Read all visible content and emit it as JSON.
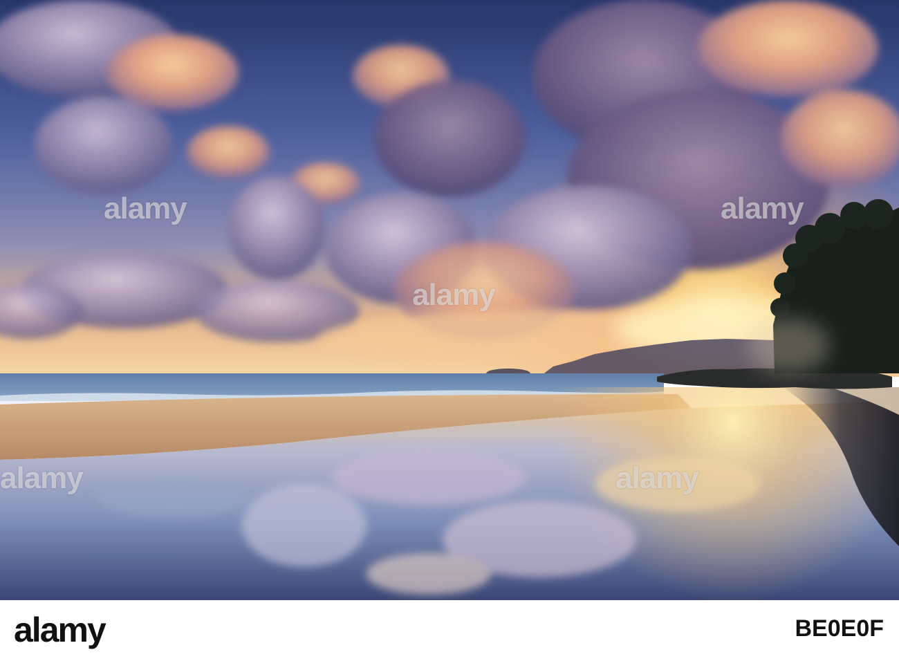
{
  "watermark": {
    "text": "alamy"
  },
  "footer": {
    "logo": "alamy",
    "image_id": "BE0E0F"
  },
  "colors": {
    "sky_top": "#2a3a6e",
    "sky_mid": "#6f80b8",
    "horizon_glow": "#ffd47a",
    "cloud_light": "#f7c48c",
    "cloud_shadow": "#6b5a86",
    "sand": "#c9a27a",
    "water_reflection": "#a9b7d6",
    "foliage": "#17201a"
  }
}
